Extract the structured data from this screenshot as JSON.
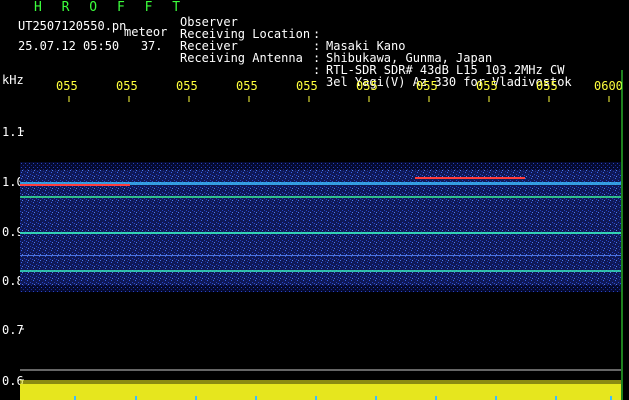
{
  "header": {
    "title": "H R O F F T",
    "filename": "UT2507120550.pn",
    "filename_suffix": "meteor",
    "datetime": "25.07.12 05:50   37.",
    "meta": [
      {
        "label": "Observer",
        "value": "Masaki Kano"
      },
      {
        "label": "Receiving Location",
        "value": "Shibukawa, Gunma, Japan"
      },
      {
        "label": "Receiver",
        "value": "RTL-SDR SDR# 43dB L15 103.2MHz CW"
      },
      {
        "label": "Receiving Antenna",
        "value": "3el Yagi(V) Az 330 for Vladivostok"
      }
    ],
    "separator": ":"
  },
  "axis": {
    "unit": "kHz",
    "y_ticks": [
      "1.1",
      "1.0",
      "0.9",
      "0.8",
      "0.7",
      "0.6"
    ],
    "x_ticks": [
      "055",
      "055",
      "055",
      "055",
      "055",
      "055",
      "055",
      "055",
      "055",
      "0600"
    ]
  },
  "colors": {
    "header_title": "#3cff3c",
    "text": "#ffffff",
    "tick": "#ffff3c",
    "background": "#000000",
    "signal_low": "#1a2a8a",
    "signal_mid": "#3c78ff",
    "signal_high": "#ff3c3c"
  }
}
